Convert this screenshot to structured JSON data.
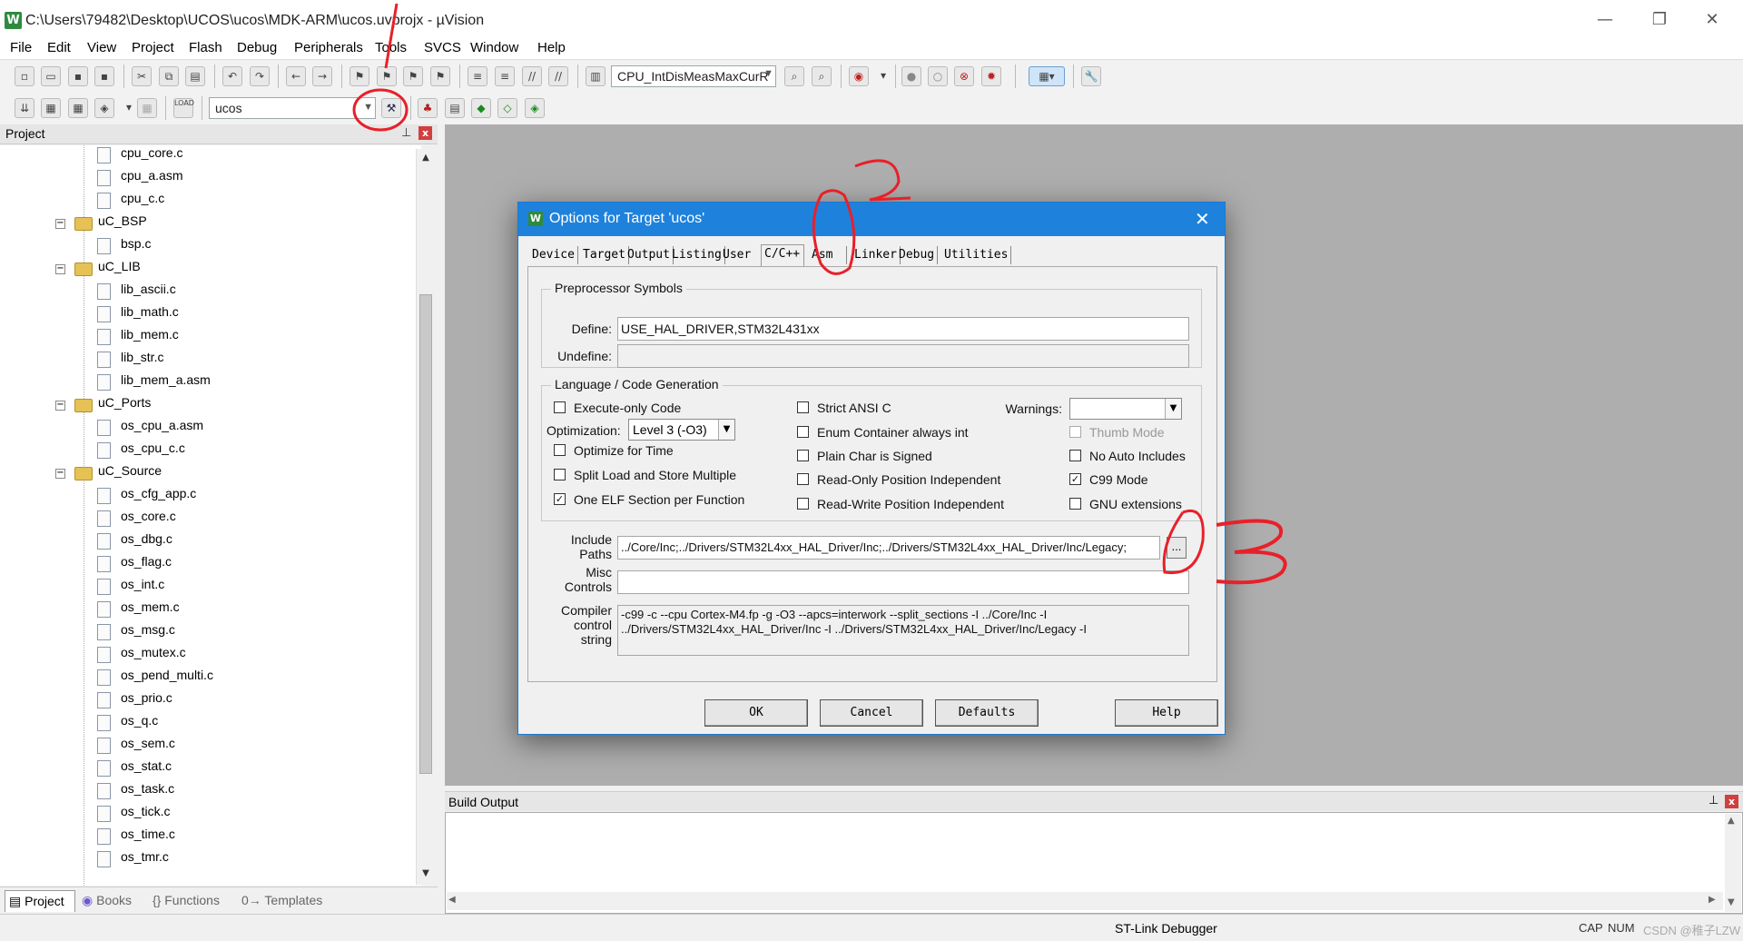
{
  "window": {
    "title": "C:\\Users\\79482\\Desktop\\UCOS\\ucos\\MDK-ARM\\ucos.uvprojx - µVision",
    "app_icon": "W",
    "minimize": "—",
    "restore": "❐",
    "close": "✕"
  },
  "menu": [
    "File",
    "Edit",
    "View",
    "Project",
    "Flash",
    "Debug",
    "Peripherals",
    "Tools",
    "SVCS",
    "Window",
    "Help"
  ],
  "toolbar": {
    "find_combo": "CPU_IntDisMeasMaxCurR",
    "target_combo": "ucos",
    "load_label": "LOAD"
  },
  "project_panel": {
    "title": "Project",
    "pin": "⊥",
    "close": "x",
    "tree": [
      {
        "type": "file",
        "label": "cpu_core.c",
        "indent": 1
      },
      {
        "type": "file",
        "label": "cpu_a.asm",
        "indent": 1
      },
      {
        "type": "file",
        "label": "cpu_c.c",
        "indent": 1
      },
      {
        "type": "folder",
        "label": "uC_BSP",
        "indent": 0,
        "toggle": "−"
      },
      {
        "type": "file",
        "label": "bsp.c",
        "indent": 1
      },
      {
        "type": "folder",
        "label": "uC_LIB",
        "indent": 0,
        "toggle": "−"
      },
      {
        "type": "file",
        "label": "lib_ascii.c",
        "indent": 1
      },
      {
        "type": "file",
        "label": "lib_math.c",
        "indent": 1
      },
      {
        "type": "file",
        "label": "lib_mem.c",
        "indent": 1
      },
      {
        "type": "file",
        "label": "lib_str.c",
        "indent": 1
      },
      {
        "type": "file",
        "label": "lib_mem_a.asm",
        "indent": 1
      },
      {
        "type": "folder",
        "label": "uC_Ports",
        "indent": 0,
        "toggle": "−"
      },
      {
        "type": "file",
        "label": "os_cpu_a.asm",
        "indent": 1
      },
      {
        "type": "file",
        "label": "os_cpu_c.c",
        "indent": 1
      },
      {
        "type": "folder",
        "label": "uC_Source",
        "indent": 0,
        "toggle": "−"
      },
      {
        "type": "file",
        "label": "os_cfg_app.c",
        "indent": 1
      },
      {
        "type": "file",
        "label": "os_core.c",
        "indent": 1
      },
      {
        "type": "file",
        "label": "os_dbg.c",
        "indent": 1
      },
      {
        "type": "file",
        "label": "os_flag.c",
        "indent": 1
      },
      {
        "type": "file",
        "label": "os_int.c",
        "indent": 1
      },
      {
        "type": "file",
        "label": "os_mem.c",
        "indent": 1
      },
      {
        "type": "file",
        "label": "os_msg.c",
        "indent": 1
      },
      {
        "type": "file",
        "label": "os_mutex.c",
        "indent": 1
      },
      {
        "type": "file",
        "label": "os_pend_multi.c",
        "indent": 1
      },
      {
        "type": "file",
        "label": "os_prio.c",
        "indent": 1
      },
      {
        "type": "file",
        "label": "os_q.c",
        "indent": 1
      },
      {
        "type": "file",
        "label": "os_sem.c",
        "indent": 1
      },
      {
        "type": "file",
        "label": "os_stat.c",
        "indent": 1
      },
      {
        "type": "file",
        "label": "os_task.c",
        "indent": 1
      },
      {
        "type": "file",
        "label": "os_tick.c",
        "indent": 1
      },
      {
        "type": "file",
        "label": "os_time.c",
        "indent": 1
      },
      {
        "type": "file",
        "label": "os_tmr.c",
        "indent": 1
      }
    ],
    "bottom_tabs": [
      {
        "label": "Project",
        "active": true
      },
      {
        "label": "Books"
      },
      {
        "label": "{} Functions"
      },
      {
        "label": "0→ Templates"
      }
    ]
  },
  "build_output": {
    "title": "Build Output",
    "pin": "⊥",
    "close": "x"
  },
  "status": {
    "debugger": "ST-Link Debugger",
    "caps": "CAP",
    "num": "NUM",
    "watermark": "CSDN @稚子LZW"
  },
  "dialog": {
    "title": "Options for Target 'ucos'",
    "icon": "W",
    "close": "✕",
    "tabs": [
      "Device",
      "Target",
      "Output",
      "Listing",
      "User",
      "C/C++",
      "Asm",
      "Linker",
      "Debug",
      "Utilities"
    ],
    "active_tab": "C/C++",
    "preprocessor": {
      "group": "Preprocessor Symbols",
      "define_label": "Define:",
      "define_value": "USE_HAL_DRIVER,STM32L431xx",
      "undefine_label": "Undefine:",
      "undefine_value": ""
    },
    "language": {
      "group": "Language / Code Generation",
      "execute_only": {
        "label": "Execute-only Code",
        "checked": false
      },
      "optimization_label": "Optimization:",
      "optimization_value": "Level 3 (-O3)",
      "optimize_time": {
        "label": "Optimize for Time",
        "checked": false
      },
      "split_load": {
        "label": "Split Load and Store Multiple",
        "checked": false
      },
      "one_elf": {
        "label": "One ELF Section per Function",
        "checked": true
      },
      "strict_ansi": {
        "label": "Strict ANSI C",
        "checked": false
      },
      "enum_container": {
        "label": "Enum Container always int",
        "checked": false
      },
      "plain_char": {
        "label": "Plain Char is Signed",
        "checked": false
      },
      "ro_pi": {
        "label": "Read-Only Position Independent",
        "checked": false
      },
      "rw_pi": {
        "label": "Read-Write Position Independent",
        "checked": false
      },
      "warnings_label": "Warnings:",
      "warnings_value": "",
      "thumb_mode": {
        "label": "Thumb Mode",
        "checked": false,
        "disabled": true
      },
      "no_auto_includes": {
        "label": "No Auto Includes",
        "checked": false
      },
      "c99_mode": {
        "label": "C99 Mode",
        "checked": true
      },
      "gnu_ext": {
        "label": "GNU extensions",
        "checked": false
      }
    },
    "include_label": "Include\nPaths",
    "include_value": "../Core/Inc;../Drivers/STM32L4xx_HAL_Driver/Inc;../Drivers/STM32L4xx_HAL_Driver/Inc/Legacy;",
    "browse": "...",
    "misc_label": "Misc\nControls",
    "misc_value": "",
    "compiler_label": "Compiler\ncontrol\nstring",
    "compiler_value": "-c99 -c --cpu Cortex-M4.fp -g -O3 --apcs=interwork --split_sections -I ../Core/Inc -I ../Drivers/STM32L4xx_HAL_Driver/Inc -I ../Drivers/STM32L4xx_HAL_Driver/Inc/Legacy -I",
    "buttons": {
      "ok": "OK",
      "cancel": "Cancel",
      "defaults": "Defaults",
      "help": "Help"
    }
  },
  "annotations": {
    "color": "#e8202a",
    "one": "1",
    "two": "2",
    "three": "3"
  }
}
